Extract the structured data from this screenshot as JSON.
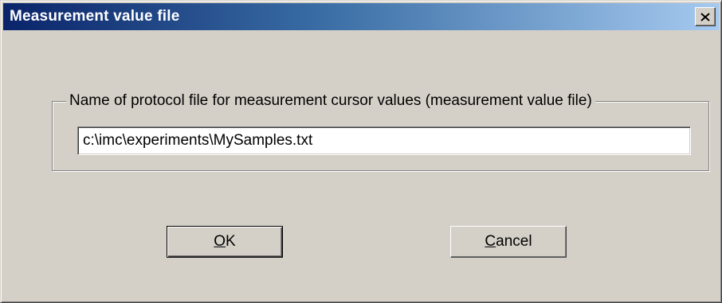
{
  "window": {
    "title": "Measurement value file",
    "close_icon": "close-icon"
  },
  "group": {
    "legend": "Name of protocol file for measurement cursor values (measurement value file)"
  },
  "path_field": {
    "value": "c:\\imc\\experiments\\MySamples.txt"
  },
  "buttons": {
    "ok": {
      "mnemonic": "O",
      "rest": "K"
    },
    "cancel": {
      "mnemonic": "C",
      "rest": "ancel"
    }
  },
  "colors": {
    "titlebar_start": "#0a246a",
    "titlebar_end": "#a6caf0",
    "face": "#d4d0c8"
  }
}
